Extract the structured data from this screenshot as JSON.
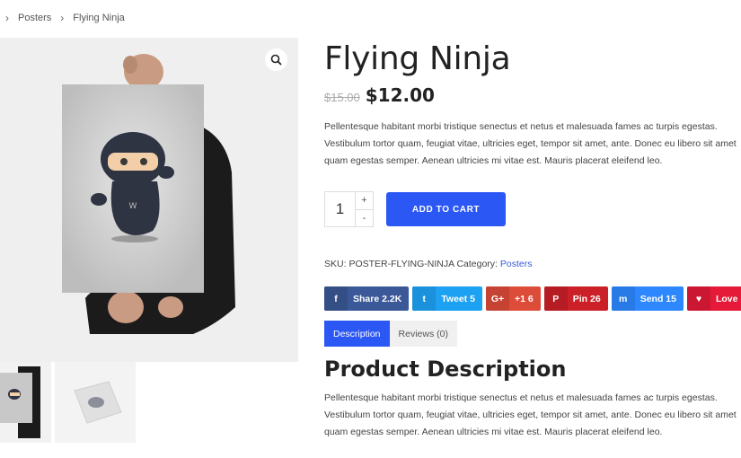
{
  "breadcrumb": {
    "items": [
      "Posters",
      "Flying Ninja"
    ]
  },
  "product": {
    "title": "Flying Ninja",
    "old_price": "$15.00",
    "price": "$12.00",
    "short_description": "Pellentesque habitant morbi tristique senectus et netus et malesuada fames ac turpis egestas. Vestibulum tortor quam, feugiat vitae, ultricies eget, tempor sit amet, ante. Donec eu libero sit amet quam egestas semper. Aenean ultricies mi vitae est. Mauris placerat eleifend leo.",
    "quantity": "1",
    "qty_plus": "+",
    "qty_minus": "-",
    "add_to_cart": "ADD TO CART",
    "sku_label": "SKU:",
    "sku": "POSTER-FLYING-NINJA",
    "category_label": "Category:",
    "category": "Posters"
  },
  "shares": [
    {
      "label": "Share 2.2K",
      "icon": "facebook-icon",
      "glyph": "f",
      "color": "#3b5998",
      "icon_color": "#344e86"
    },
    {
      "label": "Tweet 5",
      "icon": "twitter-icon",
      "glyph": "t",
      "color": "#1da1f2",
      "icon_color": "#1a91da"
    },
    {
      "label": "+1 6",
      "icon": "google-plus-icon",
      "glyph": "G+",
      "color": "#dd4b39",
      "icon_color": "#c64333"
    },
    {
      "label": "Pin 26",
      "icon": "pinterest-icon",
      "glyph": "P",
      "color": "#cb2027",
      "icon_color": "#b51c23"
    },
    {
      "label": "Send 15",
      "icon": "messenger-icon",
      "glyph": "m",
      "color": "#2d88ff",
      "icon_color": "#287ae6"
    },
    {
      "label": "Love",
      "icon": "heart-icon",
      "glyph": "♥",
      "color": "#e51a38",
      "icon_color": "#cc1732"
    }
  ],
  "tabs": [
    {
      "label": "Description",
      "active": true
    },
    {
      "label": "Reviews (0)",
      "active": false
    }
  ],
  "description_section": {
    "title": "Product Description",
    "text": "Pellentesque habitant morbi tristique senectus et netus et malesuada fames ac turpis egestas. Vestibulum tortor quam, feugiat vitae, ultricies eget, tempor sit amet, ante. Donec eu libero sit amet quam egestas semper. Aenean ultricies mi vitae est. Mauris placerat eleifend leo."
  },
  "colors": {
    "accent": "#2b57f5",
    "link": "#3b5bdb"
  }
}
